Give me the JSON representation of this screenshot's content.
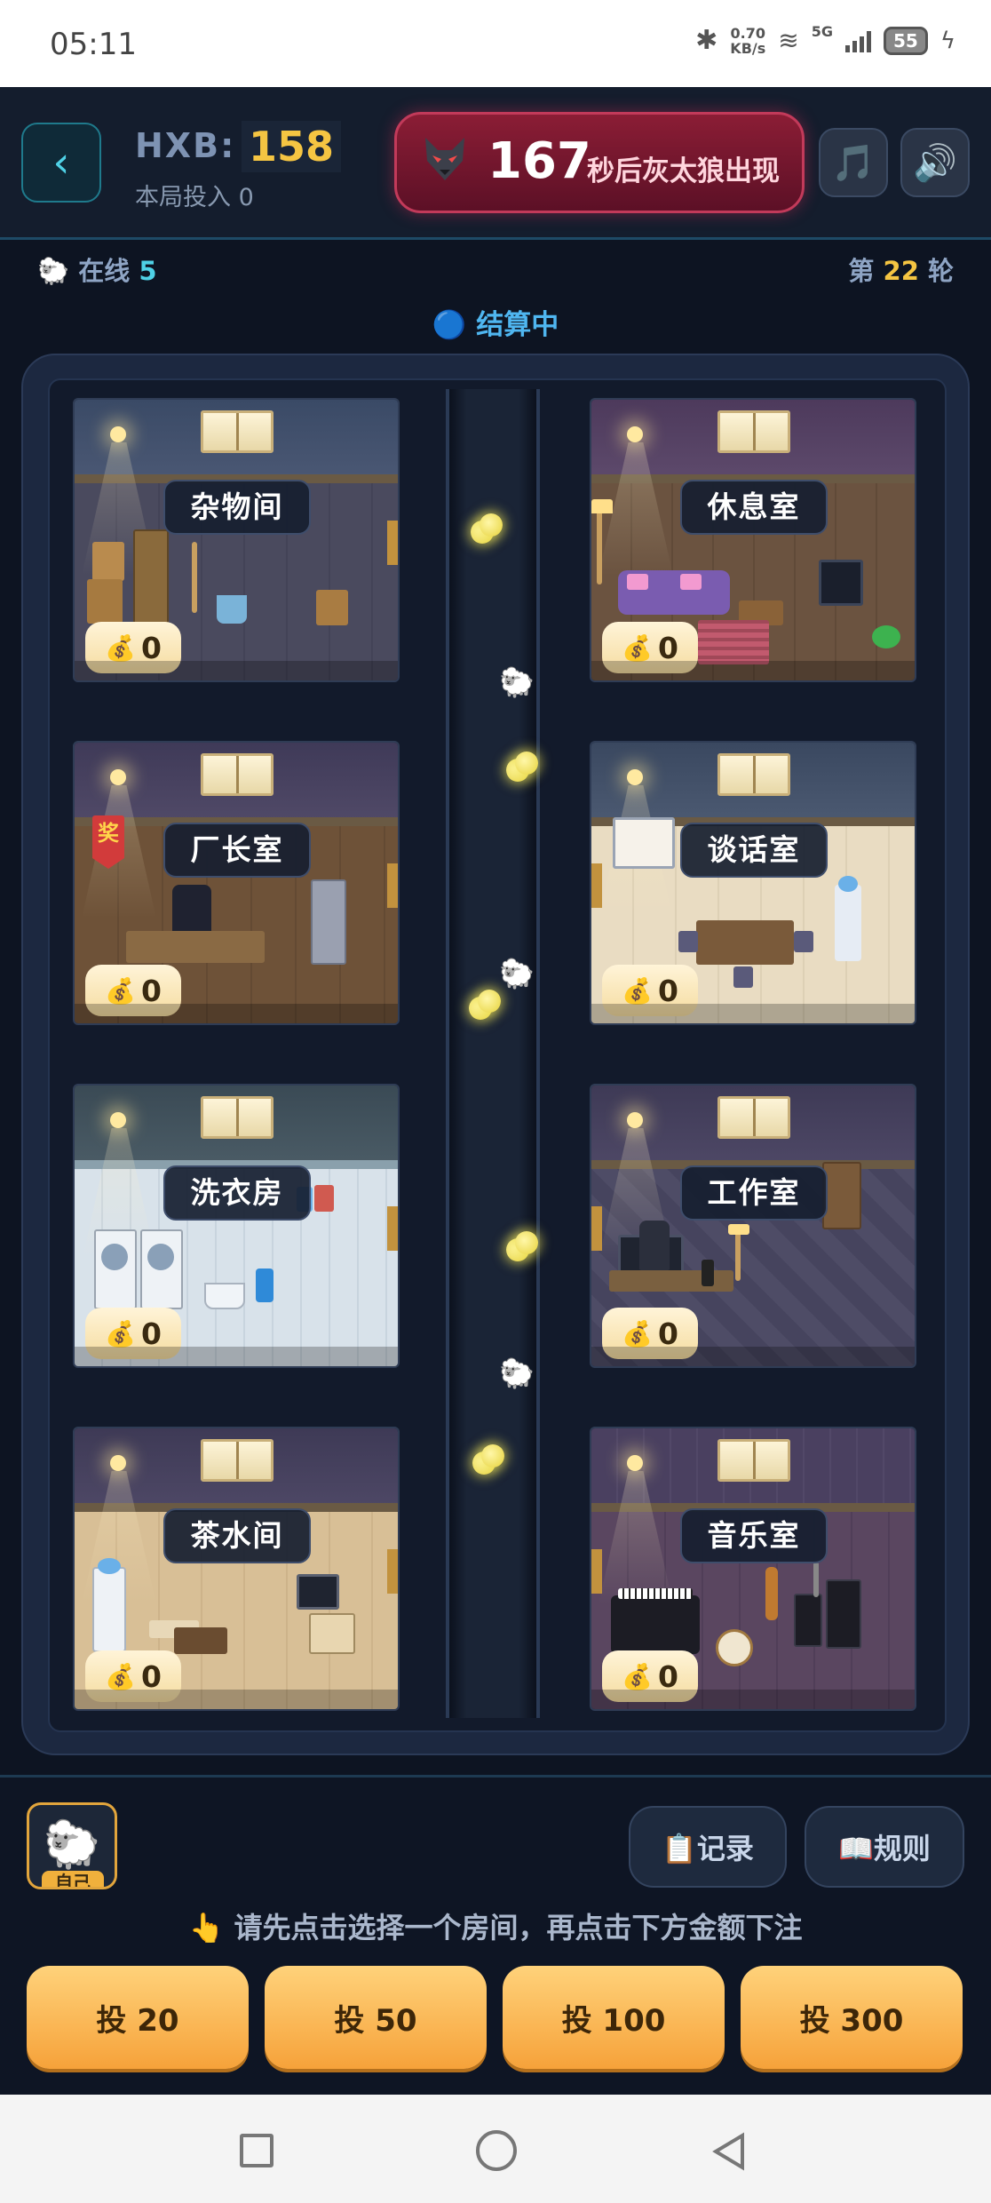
{
  "status_bar": {
    "time": "05:11",
    "speed_value": "0.70",
    "speed_unit": "KB/s",
    "network": "5G",
    "battery": "55"
  },
  "header": {
    "currency_label": "HXB:",
    "currency_value": "158",
    "round_bet": "本局投入 0",
    "countdown_number": "167",
    "countdown_text": "秒后灰太狼出现"
  },
  "info": {
    "online_label": "在线",
    "online_count": "5",
    "round_prefix": "第",
    "round_number": "22",
    "round_suffix": "轮",
    "settle_status": "结算中"
  },
  "rooms": [
    {
      "name": "杂物间",
      "bet": "0"
    },
    {
      "name": "休息室",
      "bet": "0"
    },
    {
      "name": "厂长室",
      "bet": "0"
    },
    {
      "name": "谈话室",
      "bet": "0"
    },
    {
      "name": "洗衣房",
      "bet": "0"
    },
    {
      "name": "工作室",
      "bet": "0"
    },
    {
      "name": "茶水间",
      "bet": "0"
    },
    {
      "name": "音乐室",
      "bet": "0"
    }
  ],
  "badge_text": "奖",
  "bottom": {
    "avatar_tag": "自己",
    "records_label": "📋记录",
    "rules_label": "📖规则",
    "hint": "👆 请先点击选择一个房间，再点击下方金额下注",
    "amounts": [
      "投 20",
      "投 50",
      "投 100",
      "投 300"
    ]
  },
  "icons": {
    "back": "chevron-left-icon",
    "wolf": "wolf-head-icon",
    "music": "music-note-icon",
    "sound": "speaker-icon",
    "sheep": "sheep-icon",
    "bag": "money-bag-icon",
    "coin": "coin-icon"
  }
}
